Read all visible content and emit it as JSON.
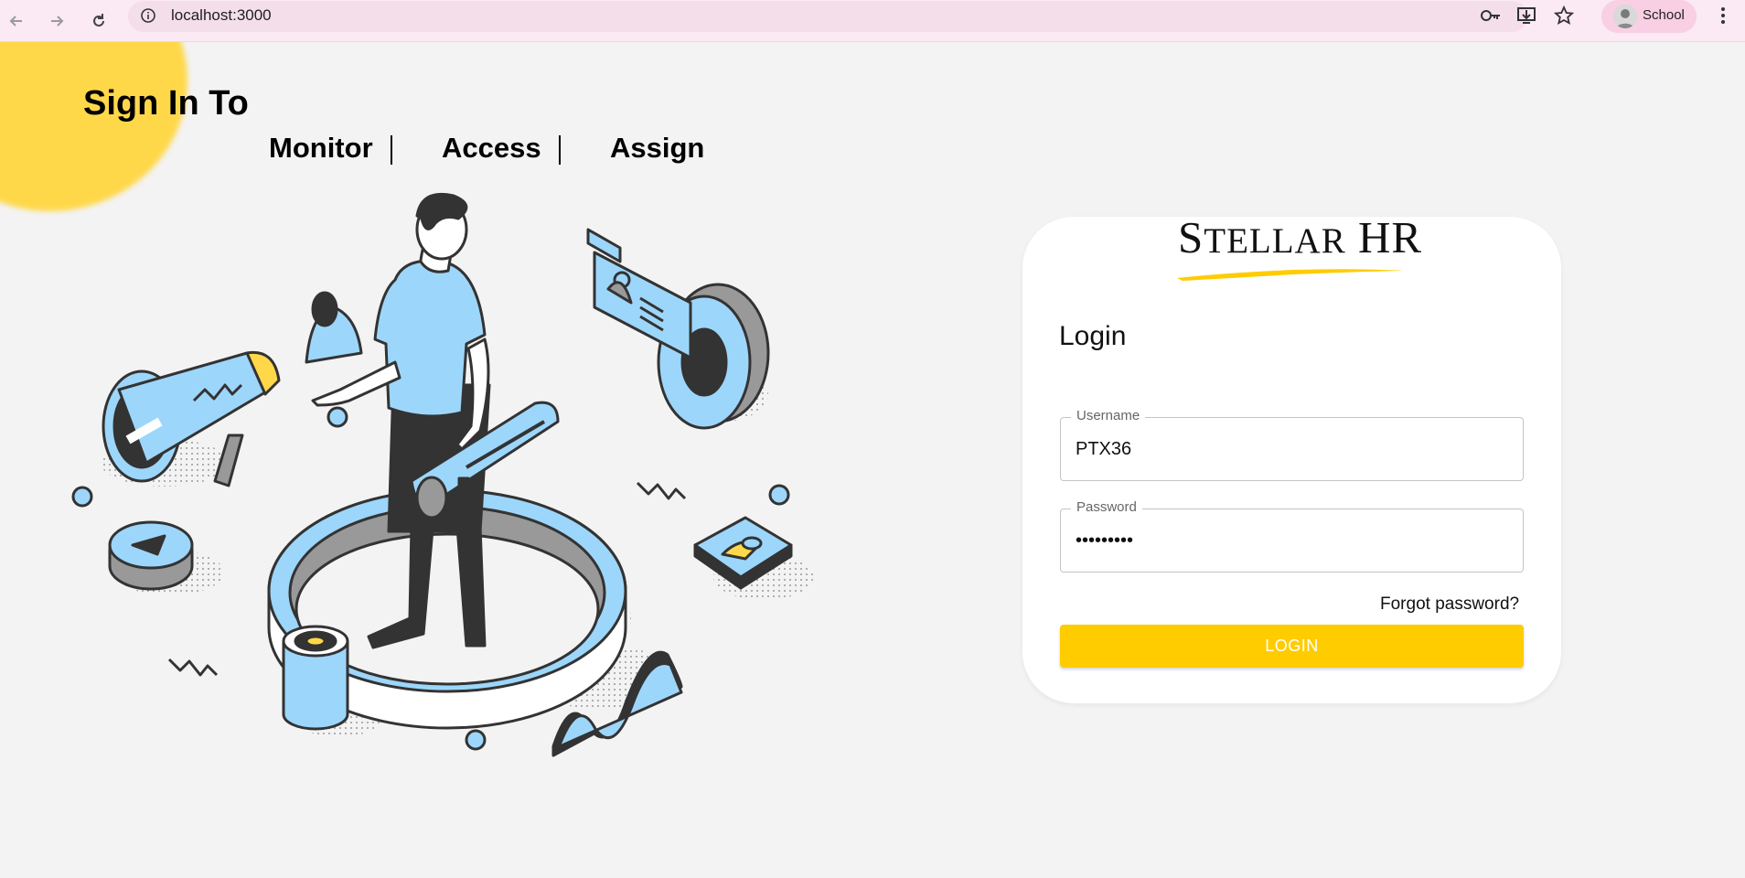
{
  "browser": {
    "url": "localhost:3000",
    "profile_name": "School",
    "icons": [
      "back-icon",
      "forward-icon",
      "reload-icon",
      "site-info-icon",
      "password-key-icon",
      "install-app-icon",
      "bookmark-star-icon",
      "menu-icon"
    ]
  },
  "hero": {
    "title": "Sign In To",
    "features": [
      "Monitor",
      "Access",
      "Assign"
    ]
  },
  "login_card": {
    "brand": {
      "initial_1": "S",
      "rest_1": "TELLAR",
      "word_2": "HR"
    },
    "heading": "Login",
    "username": {
      "label": "Username",
      "value": "PTX36"
    },
    "password": {
      "label": "Password",
      "value": "•••••••••"
    },
    "forgot_link": "Forgot password?",
    "login_button": "LOGIN"
  },
  "colors": {
    "accent": "#ffcc00",
    "blob": "#ffd84a",
    "illustration_blue": "#9dd6fb",
    "illustration_dark": "#333333"
  }
}
